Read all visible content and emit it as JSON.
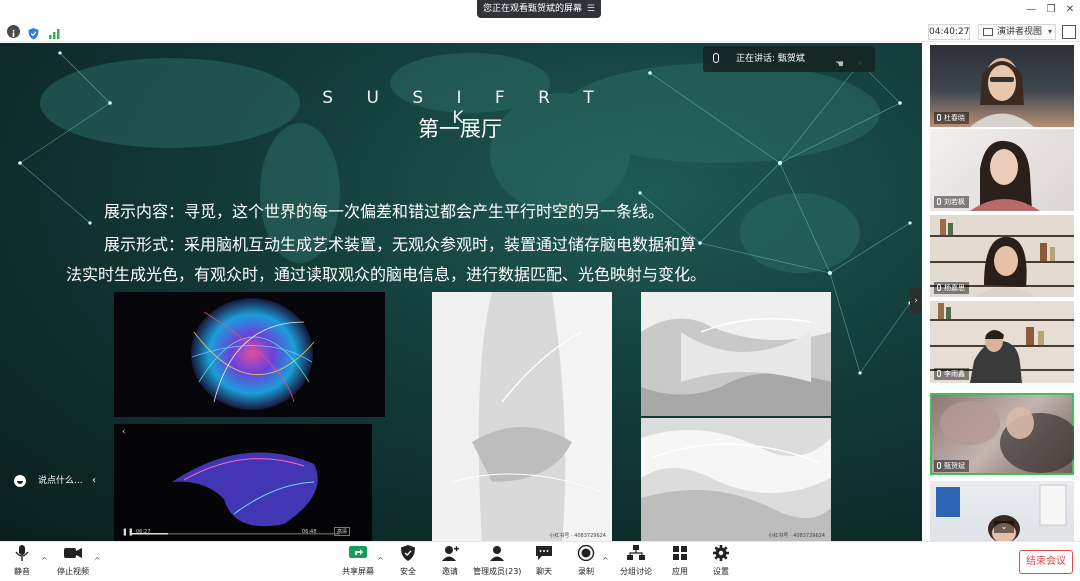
{
  "window": {
    "share_banner": "您正在观看甄贺斌的屏幕",
    "minimize_icon": "minimize-icon",
    "restore_icon": "restore-icon",
    "close_icon": "close-icon"
  },
  "status": {
    "icons": [
      "info-icon",
      "shield-icon",
      "signal-icon"
    ],
    "timer": "04:40:27",
    "view_mode": "演讲者视图"
  },
  "slide": {
    "brand": "S U S I F R T K",
    "hall": "第一展厅",
    "lines": [
      "展示内容：寻觅，这个世界的每一次偏差和错过都会产生平行时空的另一条线。",
      "展示形式：采用脑机互动生成艺术装置，无观众参观时，装置通过储存脑电数据和算",
      "法实时生成光色，有观众时，通过读取观众的脑电信息，进行数据匹配、光色映射与变化。"
    ],
    "video_time_left": "06:27",
    "video_time_right": "06:48",
    "video_hd": "高清",
    "image_caption": "小红书号 · 4083729624"
  },
  "speaking": {
    "label": "正在讲话: 甄贺斌"
  },
  "comment": {
    "placeholder": "说点什么..."
  },
  "participants": [
    {
      "name": "杜春晓"
    },
    {
      "name": "刘若枫"
    },
    {
      "name": "杨嘉思"
    },
    {
      "name": "李雨鑫"
    },
    {
      "name": "甄贺斌"
    }
  ],
  "toolbar": {
    "mute": "静音",
    "stop_video": "停止视频",
    "share": "共享屏幕",
    "security": "安全",
    "invite": "邀请",
    "members": "管理成员(23)",
    "chat": "聊天",
    "record": "录制",
    "breakout": "分组讨论",
    "apps": "应用",
    "settings": "设置",
    "end": "结束会议"
  },
  "colors": {
    "end": "#e04a4a",
    "active_speaker": "#3fbf5a",
    "share_green": "#1a9c5b",
    "slide_bg": "#123a37"
  }
}
